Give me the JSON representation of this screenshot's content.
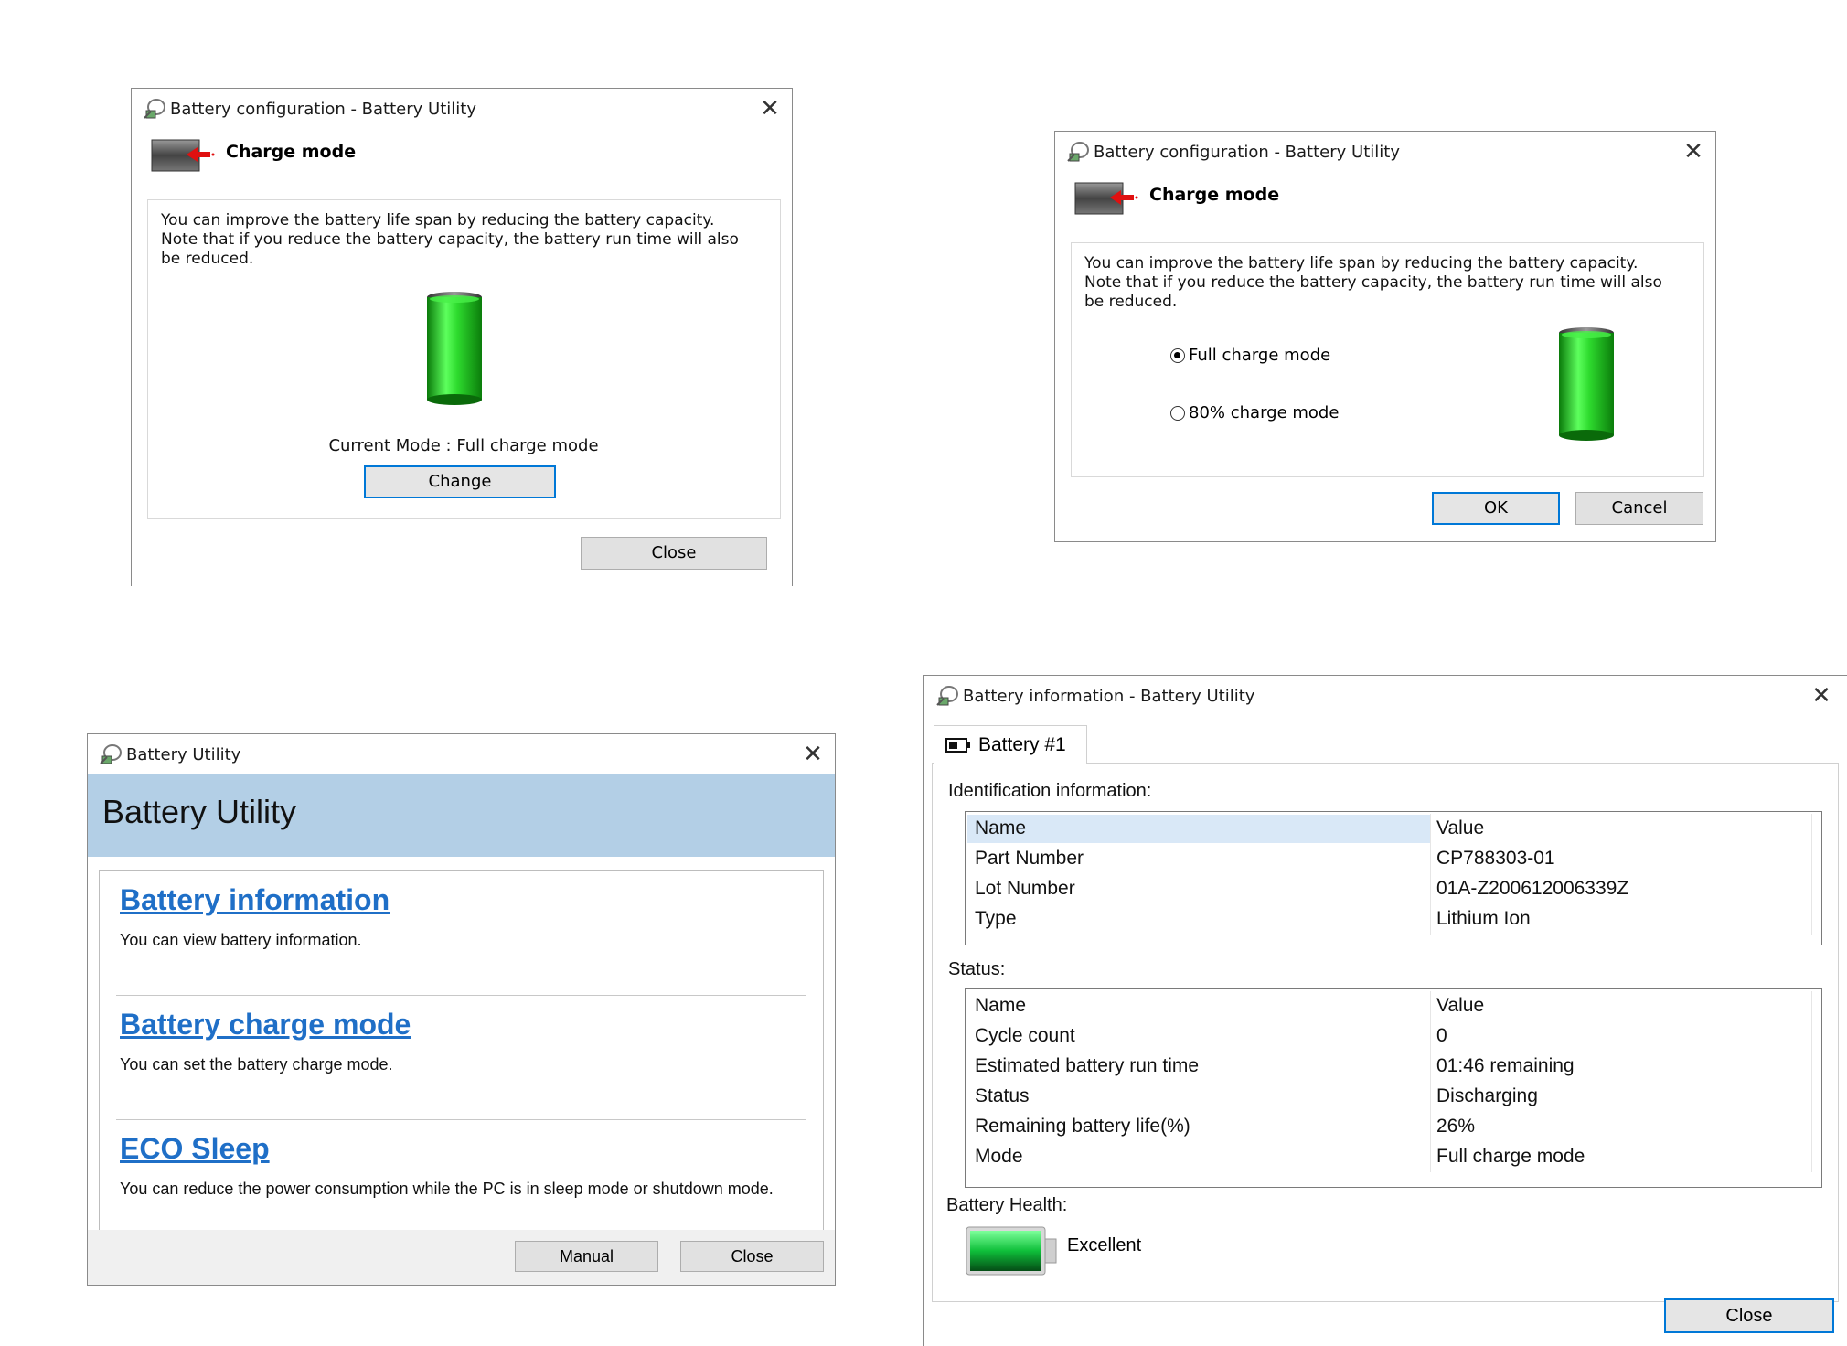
{
  "charge_window": {
    "title": "Battery configuration - Battery Utility",
    "header": "Charge mode",
    "description": "You can improve the battery life span by reducing the battery capacity. Note that if you reduce the battery capacity, the battery run time will also be reduced.",
    "current_mode": "Current Mode : Full charge mode",
    "change_label": "Change",
    "close_label": "Close"
  },
  "charge_dialog": {
    "title": "Battery configuration - Battery Utility",
    "header": "Charge mode",
    "description": "You can improve the battery life span by reducing the battery capacity. Note that if you reduce the battery capacity, the battery run time will also be reduced.",
    "options": [
      {
        "label": "Full charge mode",
        "selected": true
      },
      {
        "label": "80% charge mode",
        "selected": false
      }
    ],
    "ok_label": "OK",
    "cancel_label": "Cancel"
  },
  "utility_window": {
    "title": "Battery Utility",
    "header": "Battery Utility",
    "items": [
      {
        "link": "Battery information",
        "desc": "You can view battery information."
      },
      {
        "link": "Battery charge mode",
        "desc": "You can set the battery charge mode."
      },
      {
        "link": "ECO Sleep",
        "desc": "You can reduce the power consumption while the PC is in sleep mode or shutdown mode."
      }
    ],
    "manual_label": "Manual",
    "close_label": "Close"
  },
  "info_window": {
    "title": "Battery information - Battery Utility",
    "tab": "Battery #1",
    "identification_label": "Identification information:",
    "identification": {
      "headers": [
        "Name",
        "Value"
      ],
      "rows": [
        [
          "Part Number",
          "CP788303-01"
        ],
        [
          "Lot Number",
          "01A-Z200612006339Z"
        ],
        [
          "Type",
          "Lithium Ion"
        ]
      ]
    },
    "status_label": "Status:",
    "status": {
      "headers": [
        "Name",
        "Value"
      ],
      "rows": [
        [
          "Cycle count",
          "0"
        ],
        [
          "Estimated battery run time",
          "01:46 remaining"
        ],
        [
          "Status",
          "Discharging"
        ],
        [
          "Remaining battery life(%)",
          "26%"
        ],
        [
          "Mode",
          "Full charge mode"
        ]
      ]
    },
    "health_label": "Battery Health:",
    "health_value": "Excellent",
    "close_label": "Close"
  },
  "colors": {
    "accent": "#0078d7",
    "link": "#1f6fc7",
    "header_band": "#b3cfe6",
    "battery_green": "#2ecc2e"
  }
}
